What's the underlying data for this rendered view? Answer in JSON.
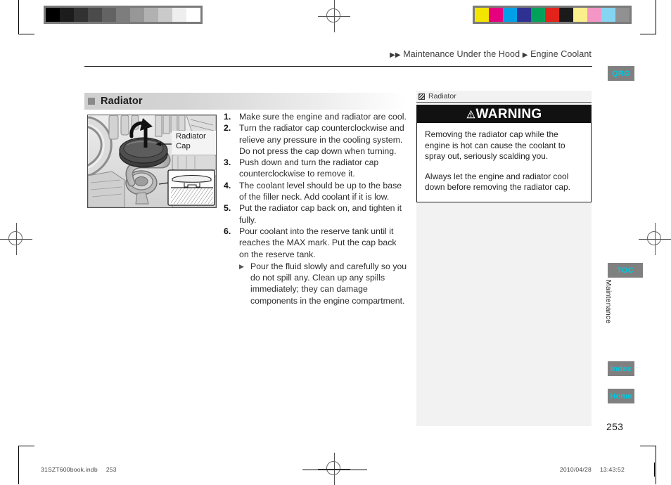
{
  "breadcrumb": {
    "arrow1": "▶▶",
    "part1": "Maintenance Under the Hood",
    "arrow2": "▶",
    "part2": "Engine Coolant"
  },
  "section": {
    "title": "Radiator"
  },
  "figure": {
    "callout_line1": "Radiator",
    "callout_line2": "Cap",
    "alt": "Engine bay illustration showing the radiator cap being turned counterclockwise, with an inset detail of the cap seated on the filler neck"
  },
  "steps": [
    {
      "num": "1.",
      "text": "Make sure the engine and radiator are cool."
    },
    {
      "num": "2.",
      "text": "Turn the radiator cap counterclockwise and relieve any pressure in the cooling system. Do not press the cap down when turning."
    },
    {
      "num": "3.",
      "text": "Push down and turn the radiator cap counterclockwise to remove it."
    },
    {
      "num": "4.",
      "text": "The coolant level should be up to the base of the filler neck. Add coolant if it is low."
    },
    {
      "num": "5.",
      "text": "Put the radiator cap back on, and tighten it fully."
    },
    {
      "num": "6.",
      "text": "Pour coolant into the reserve tank until it reaches the MAX mark. Put the cap back on the reserve tank."
    }
  ],
  "substep": {
    "bullet": "▶",
    "text": "Pour the fluid slowly and carefully so you do not spill any. Clean up any spills immediately; they can damage components in the engine compartment."
  },
  "sidebar": {
    "reference_label": "Radiator",
    "warning": {
      "heading": "WARNING",
      "paragraphs": [
        "Removing the radiator cap while the engine is hot can cause the coolant to spray out, seriously scalding you.",
        "Always let the engine and radiator cool down before removing the radiator cap."
      ]
    }
  },
  "nav_tabs": [
    {
      "label": "QRG"
    },
    {
      "label": "TOC"
    },
    {
      "label": "Index"
    },
    {
      "label": "Home"
    }
  ],
  "chapter_label": "Maintenance",
  "page_number": "253",
  "footer": {
    "file_name": "31SZT600book.indb",
    "file_page": "253",
    "date": "2010/04/28",
    "time": "13:43:52"
  },
  "calibration": {
    "gray_steps": [
      "#000000",
      "#1c1c1c",
      "#323232",
      "#4b4b4b",
      "#636363",
      "#7d7d7d",
      "#979797",
      "#b1b1b1",
      "#cacaca",
      "#eeeeee",
      "#ffffff"
    ],
    "color_steps": [
      "#f3e500",
      "#e6007e",
      "#00a0e9",
      "#2e3192",
      "#00a15a",
      "#e2231a",
      "#1a1a1a",
      "#faef8a",
      "#f396c6",
      "#85d4f2",
      "#919191"
    ]
  },
  "colors": {
    "tab_bg": "#808080",
    "tab_text": "#00c8e0",
    "warning_bar_bg": "#111111",
    "sidebar_bg": "#f2f2f2"
  }
}
